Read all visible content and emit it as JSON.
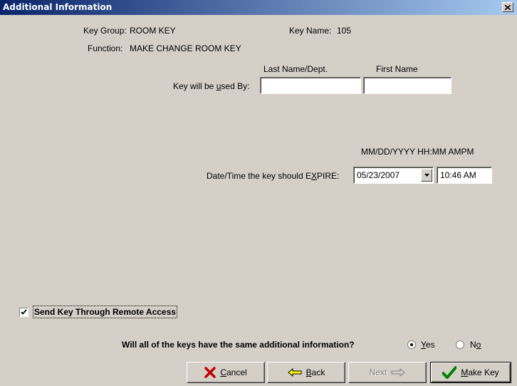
{
  "window": {
    "title": "Additional Information",
    "close_icon": "close-icon"
  },
  "info": {
    "key_group_label": "Key Group:",
    "key_group_value": "ROOM KEY",
    "key_name_label": "Key Name:",
    "key_name_value": "105",
    "function_label": "Function:",
    "function_value": "MAKE CHANGE ROOM KEY"
  },
  "used_by": {
    "label_prefix": "Key will be ",
    "label_accel": "u",
    "label_suffix": "sed By:",
    "last_name_header": "Last Name/Dept.",
    "first_name_header": "First Name",
    "last_name_value": "",
    "first_name_value": ""
  },
  "expire": {
    "format_hint": "MM/DD/YYYY  HH:MM AMPM",
    "label_prefix": "Date/Time the key should E",
    "label_accel": "X",
    "label_suffix": "PIRE:",
    "date_value": "05/23/2007",
    "time_value": "10:46 AM"
  },
  "remote_access": {
    "label": "Send Key Through Remote Access",
    "checked": true
  },
  "same_info": {
    "question": "Will all of the keys have the same additional information?",
    "yes_accel": "Y",
    "yes_rest": "es",
    "no_prefix": "N",
    "no_accel": "o",
    "selected": "Yes"
  },
  "buttons": {
    "cancel_accel": "C",
    "cancel_rest": "ancel",
    "back_accel": "B",
    "back_rest": "ack",
    "next_label": "Next",
    "make_key_accel": "M",
    "make_key_rest": "ake Key"
  },
  "colors": {
    "titlebar_start": "#0a246a",
    "titlebar_end": "#a6caf0",
    "face": "#d4d0c8"
  }
}
